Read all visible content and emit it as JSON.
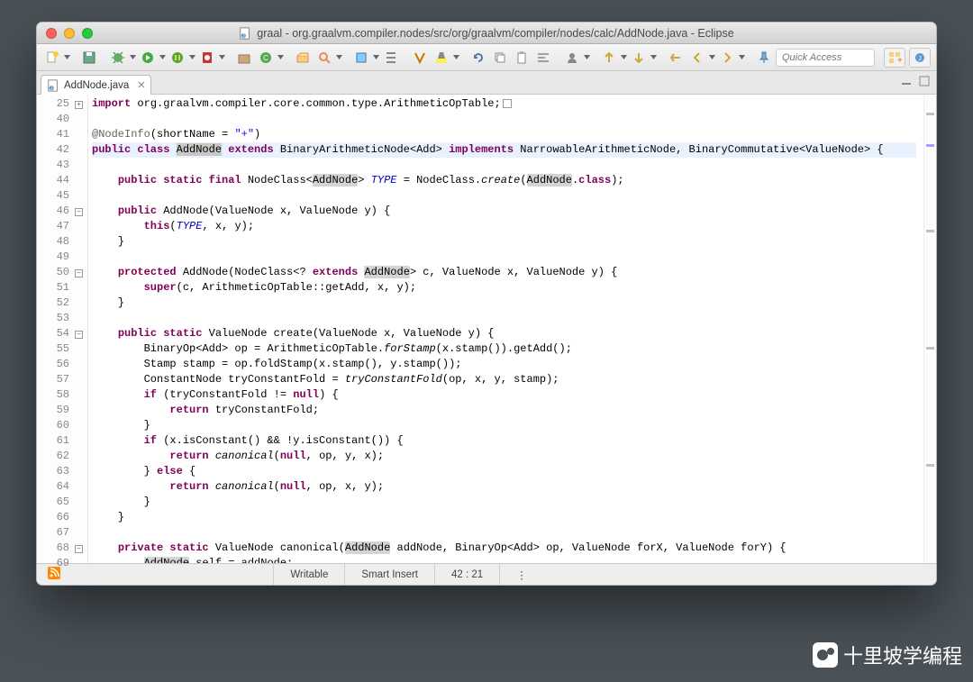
{
  "window": {
    "title": "graal - org.graalvm.compiler.nodes/src/org/graalvm/compiler/nodes/calc/AddNode.java - Eclipse"
  },
  "toolbar": {
    "quick_access_placeholder": "Quick Access"
  },
  "tab": {
    "filename": "AddNode.java",
    "close_glyph": "✕"
  },
  "statusbar": {
    "writable": "Writable",
    "insert_mode": "Smart Insert",
    "cursor": "42 : 21"
  },
  "code": {
    "lines": [
      {
        "n": 25,
        "fold": "plus",
        "tokens": [
          [
            "kw",
            "import"
          ],
          [
            "",
            " org.graalvm.compiler.core.common.type.ArithmeticOpTable;"
          ],
          [
            "box",
            ""
          ]
        ]
      },
      {
        "n": 40,
        "tokens": []
      },
      {
        "n": 41,
        "tokens": [
          [
            "ann",
            "@NodeInfo"
          ],
          [
            "",
            "(shortName = "
          ],
          [
            "str",
            "\"+\""
          ],
          [
            "",
            ")"
          ]
        ]
      },
      {
        "n": 42,
        "hl": true,
        "tokens": [
          [
            "kw",
            "public class "
          ],
          [
            "sel",
            "AddNode"
          ],
          [
            "kw",
            " extends"
          ],
          [
            "",
            " BinaryArithmeticNode<Add> "
          ],
          [
            "kw",
            "implements"
          ],
          [
            "",
            " NarrowableArithmeticNode, BinaryCommutative<ValueNode> {"
          ]
        ]
      },
      {
        "n": 43,
        "tokens": []
      },
      {
        "n": 44,
        "tokens": [
          [
            "",
            "    "
          ],
          [
            "kw",
            "public static final"
          ],
          [
            "",
            " NodeClass<"
          ],
          [
            "occ",
            "AddNode"
          ],
          [
            "",
            "> "
          ],
          [
            "it",
            "TYPE"
          ],
          [
            "",
            " = NodeClass."
          ],
          [
            "st",
            "create"
          ],
          [
            "",
            "("
          ],
          [
            "occ",
            "AddNode"
          ],
          [
            "",
            "."
          ],
          [
            "kw",
            "class"
          ],
          [
            "",
            ");"
          ]
        ]
      },
      {
        "n": 45,
        "tokens": []
      },
      {
        "n": 46,
        "fold": "minus",
        "tokens": [
          [
            "",
            "    "
          ],
          [
            "kw",
            "public"
          ],
          [
            "",
            " AddNode(ValueNode x, ValueNode y) {"
          ]
        ]
      },
      {
        "n": 47,
        "tokens": [
          [
            "",
            "        "
          ],
          [
            "kw",
            "this"
          ],
          [
            "",
            "("
          ],
          [
            "it",
            "TYPE"
          ],
          [
            "",
            ", x, y);"
          ]
        ]
      },
      {
        "n": 48,
        "tokens": [
          [
            "",
            "    }"
          ]
        ]
      },
      {
        "n": 49,
        "tokens": []
      },
      {
        "n": 50,
        "fold": "minus",
        "tokens": [
          [
            "",
            "    "
          ],
          [
            "kw",
            "protected"
          ],
          [
            "",
            " AddNode(NodeClass<? "
          ],
          [
            "kw",
            "extends"
          ],
          [
            "",
            " "
          ],
          [
            "occ",
            "AddNode"
          ],
          [
            "",
            "> c, ValueNode x, ValueNode y) {"
          ]
        ]
      },
      {
        "n": 51,
        "tokens": [
          [
            "",
            "        "
          ],
          [
            "kw",
            "super"
          ],
          [
            "",
            "(c, ArithmeticOpTable::getAdd, x, y);"
          ]
        ]
      },
      {
        "n": 52,
        "tokens": [
          [
            "",
            "    }"
          ]
        ]
      },
      {
        "n": 53,
        "tokens": []
      },
      {
        "n": 54,
        "fold": "minus",
        "tokens": [
          [
            "",
            "    "
          ],
          [
            "kw",
            "public static"
          ],
          [
            "",
            " ValueNode create(ValueNode x, ValueNode y) {"
          ]
        ]
      },
      {
        "n": 55,
        "tokens": [
          [
            "",
            "        BinaryOp<Add> op = ArithmeticOpTable."
          ],
          [
            "st",
            "forStamp"
          ],
          [
            "",
            "(x.stamp()).getAdd();"
          ]
        ]
      },
      {
        "n": 56,
        "tokens": [
          [
            "",
            "        Stamp stamp = op.foldStamp(x.stamp(), y.stamp());"
          ]
        ]
      },
      {
        "n": 57,
        "tokens": [
          [
            "",
            "        ConstantNode tryConstantFold = "
          ],
          [
            "st",
            "tryConstantFold"
          ],
          [
            "",
            "(op, x, y, stamp);"
          ]
        ]
      },
      {
        "n": 58,
        "tokens": [
          [
            "",
            "        "
          ],
          [
            "kw",
            "if"
          ],
          [
            "",
            " (tryConstantFold != "
          ],
          [
            "kw",
            "null"
          ],
          [
            "",
            ") {"
          ]
        ]
      },
      {
        "n": 59,
        "tokens": [
          [
            "",
            "            "
          ],
          [
            "kw",
            "return"
          ],
          [
            "",
            " tryConstantFold;"
          ]
        ]
      },
      {
        "n": 60,
        "tokens": [
          [
            "",
            "        }"
          ]
        ]
      },
      {
        "n": 61,
        "tokens": [
          [
            "",
            "        "
          ],
          [
            "kw",
            "if"
          ],
          [
            "",
            " (x.isConstant() && !y.isConstant()) {"
          ]
        ]
      },
      {
        "n": 62,
        "tokens": [
          [
            "",
            "            "
          ],
          [
            "kw",
            "return"
          ],
          [
            "",
            " "
          ],
          [
            "st",
            "canonical"
          ],
          [
            "",
            "("
          ],
          [
            "kw",
            "null"
          ],
          [
            "",
            ", op, y, x);"
          ]
        ]
      },
      {
        "n": 63,
        "tokens": [
          [
            "",
            "        } "
          ],
          [
            "kw",
            "else"
          ],
          [
            "",
            " {"
          ]
        ]
      },
      {
        "n": 64,
        "tokens": [
          [
            "",
            "            "
          ],
          [
            "kw",
            "return"
          ],
          [
            "",
            " "
          ],
          [
            "st",
            "canonical"
          ],
          [
            "",
            "("
          ],
          [
            "kw",
            "null"
          ],
          [
            "",
            ", op, x, y);"
          ]
        ]
      },
      {
        "n": 65,
        "tokens": [
          [
            "",
            "        }"
          ]
        ]
      },
      {
        "n": 66,
        "tokens": [
          [
            "",
            "    }"
          ]
        ]
      },
      {
        "n": 67,
        "tokens": []
      },
      {
        "n": 68,
        "fold": "minus",
        "tokens": [
          [
            "",
            "    "
          ],
          [
            "kw",
            "private static"
          ],
          [
            "",
            " ValueNode canonical("
          ],
          [
            "occ",
            "AddNode"
          ],
          [
            "",
            " addNode, BinaryOp<Add> op, ValueNode forX, ValueNode forY) {"
          ]
        ]
      },
      {
        "n": 69,
        "tokens": [
          [
            "",
            "        "
          ],
          [
            "occ",
            "AddNode"
          ],
          [
            "",
            " self = addNode;"
          ]
        ]
      }
    ]
  },
  "watermark": {
    "text": "十里坡学编程"
  }
}
